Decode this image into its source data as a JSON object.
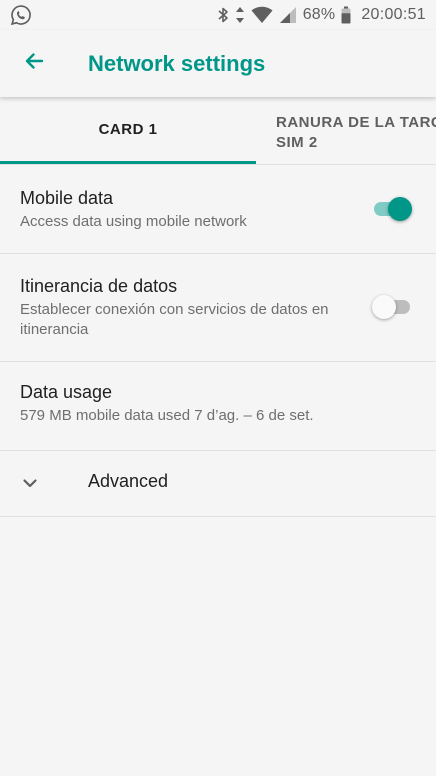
{
  "status_bar": {
    "app_notification_icon": "whatsapp-icon",
    "icons": [
      "bluetooth-icon",
      "data-transfer-icon",
      "wifi-icon",
      "cellular-signal-icon",
      "battery-icon"
    ],
    "battery_percent": "68%",
    "time": "20:00:51"
  },
  "app_bar": {
    "back_icon": "back-arrow-icon",
    "title": "Network settings"
  },
  "tabs": [
    {
      "label": "CARD 1",
      "selected": true
    },
    {
      "label": "RANURA DE LA TARG SIM 2",
      "label_line1": "RANURA DE LA TARG",
      "label_line2": "SIM 2",
      "selected": false
    }
  ],
  "settings": {
    "mobile_data": {
      "title": "Mobile data",
      "subtitle": "Access data using mobile network",
      "enabled": true
    },
    "roaming": {
      "title": "Itinerancia de datos",
      "subtitle": "Establecer conexión con servicios de datos en itinerancia",
      "enabled": false
    },
    "data_usage": {
      "title": "Data usage",
      "subtitle": "579 MB mobile data used 7 d’ag. – 6 de set."
    },
    "advanced": {
      "icon": "chevron-down-icon",
      "label": "Advanced"
    }
  },
  "colors": {
    "accent": "#009688",
    "accent_light": "#80cbc4",
    "background": "#f5f5f5",
    "text_primary": "#212121",
    "text_secondary": "#6f6f6f",
    "divider": "#e0e0e0"
  }
}
